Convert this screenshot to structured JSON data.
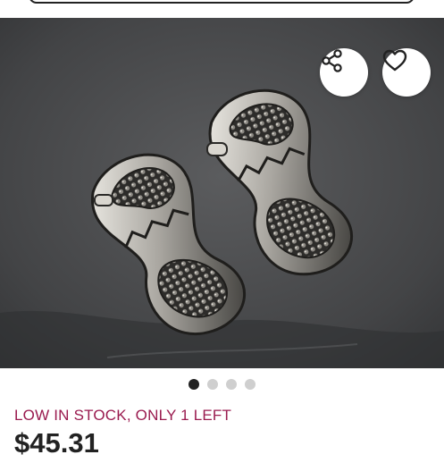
{
  "header": {
    "search_bar_visible": true
  },
  "gallery": {
    "image_description_icon": "earring-photo",
    "share_icon": "share-icon",
    "favorite_icon": "heart-icon",
    "total_images": 4,
    "active_index": 0
  },
  "listing": {
    "stock_text": "LOW IN STOCK, ONLY 1 LEFT",
    "price": "$45.31"
  },
  "colors": {
    "stock_accent": "#9a1b4f",
    "price_text": "#222222",
    "active_dot": "#222222",
    "inactive_dot": "#cfcfcf"
  }
}
